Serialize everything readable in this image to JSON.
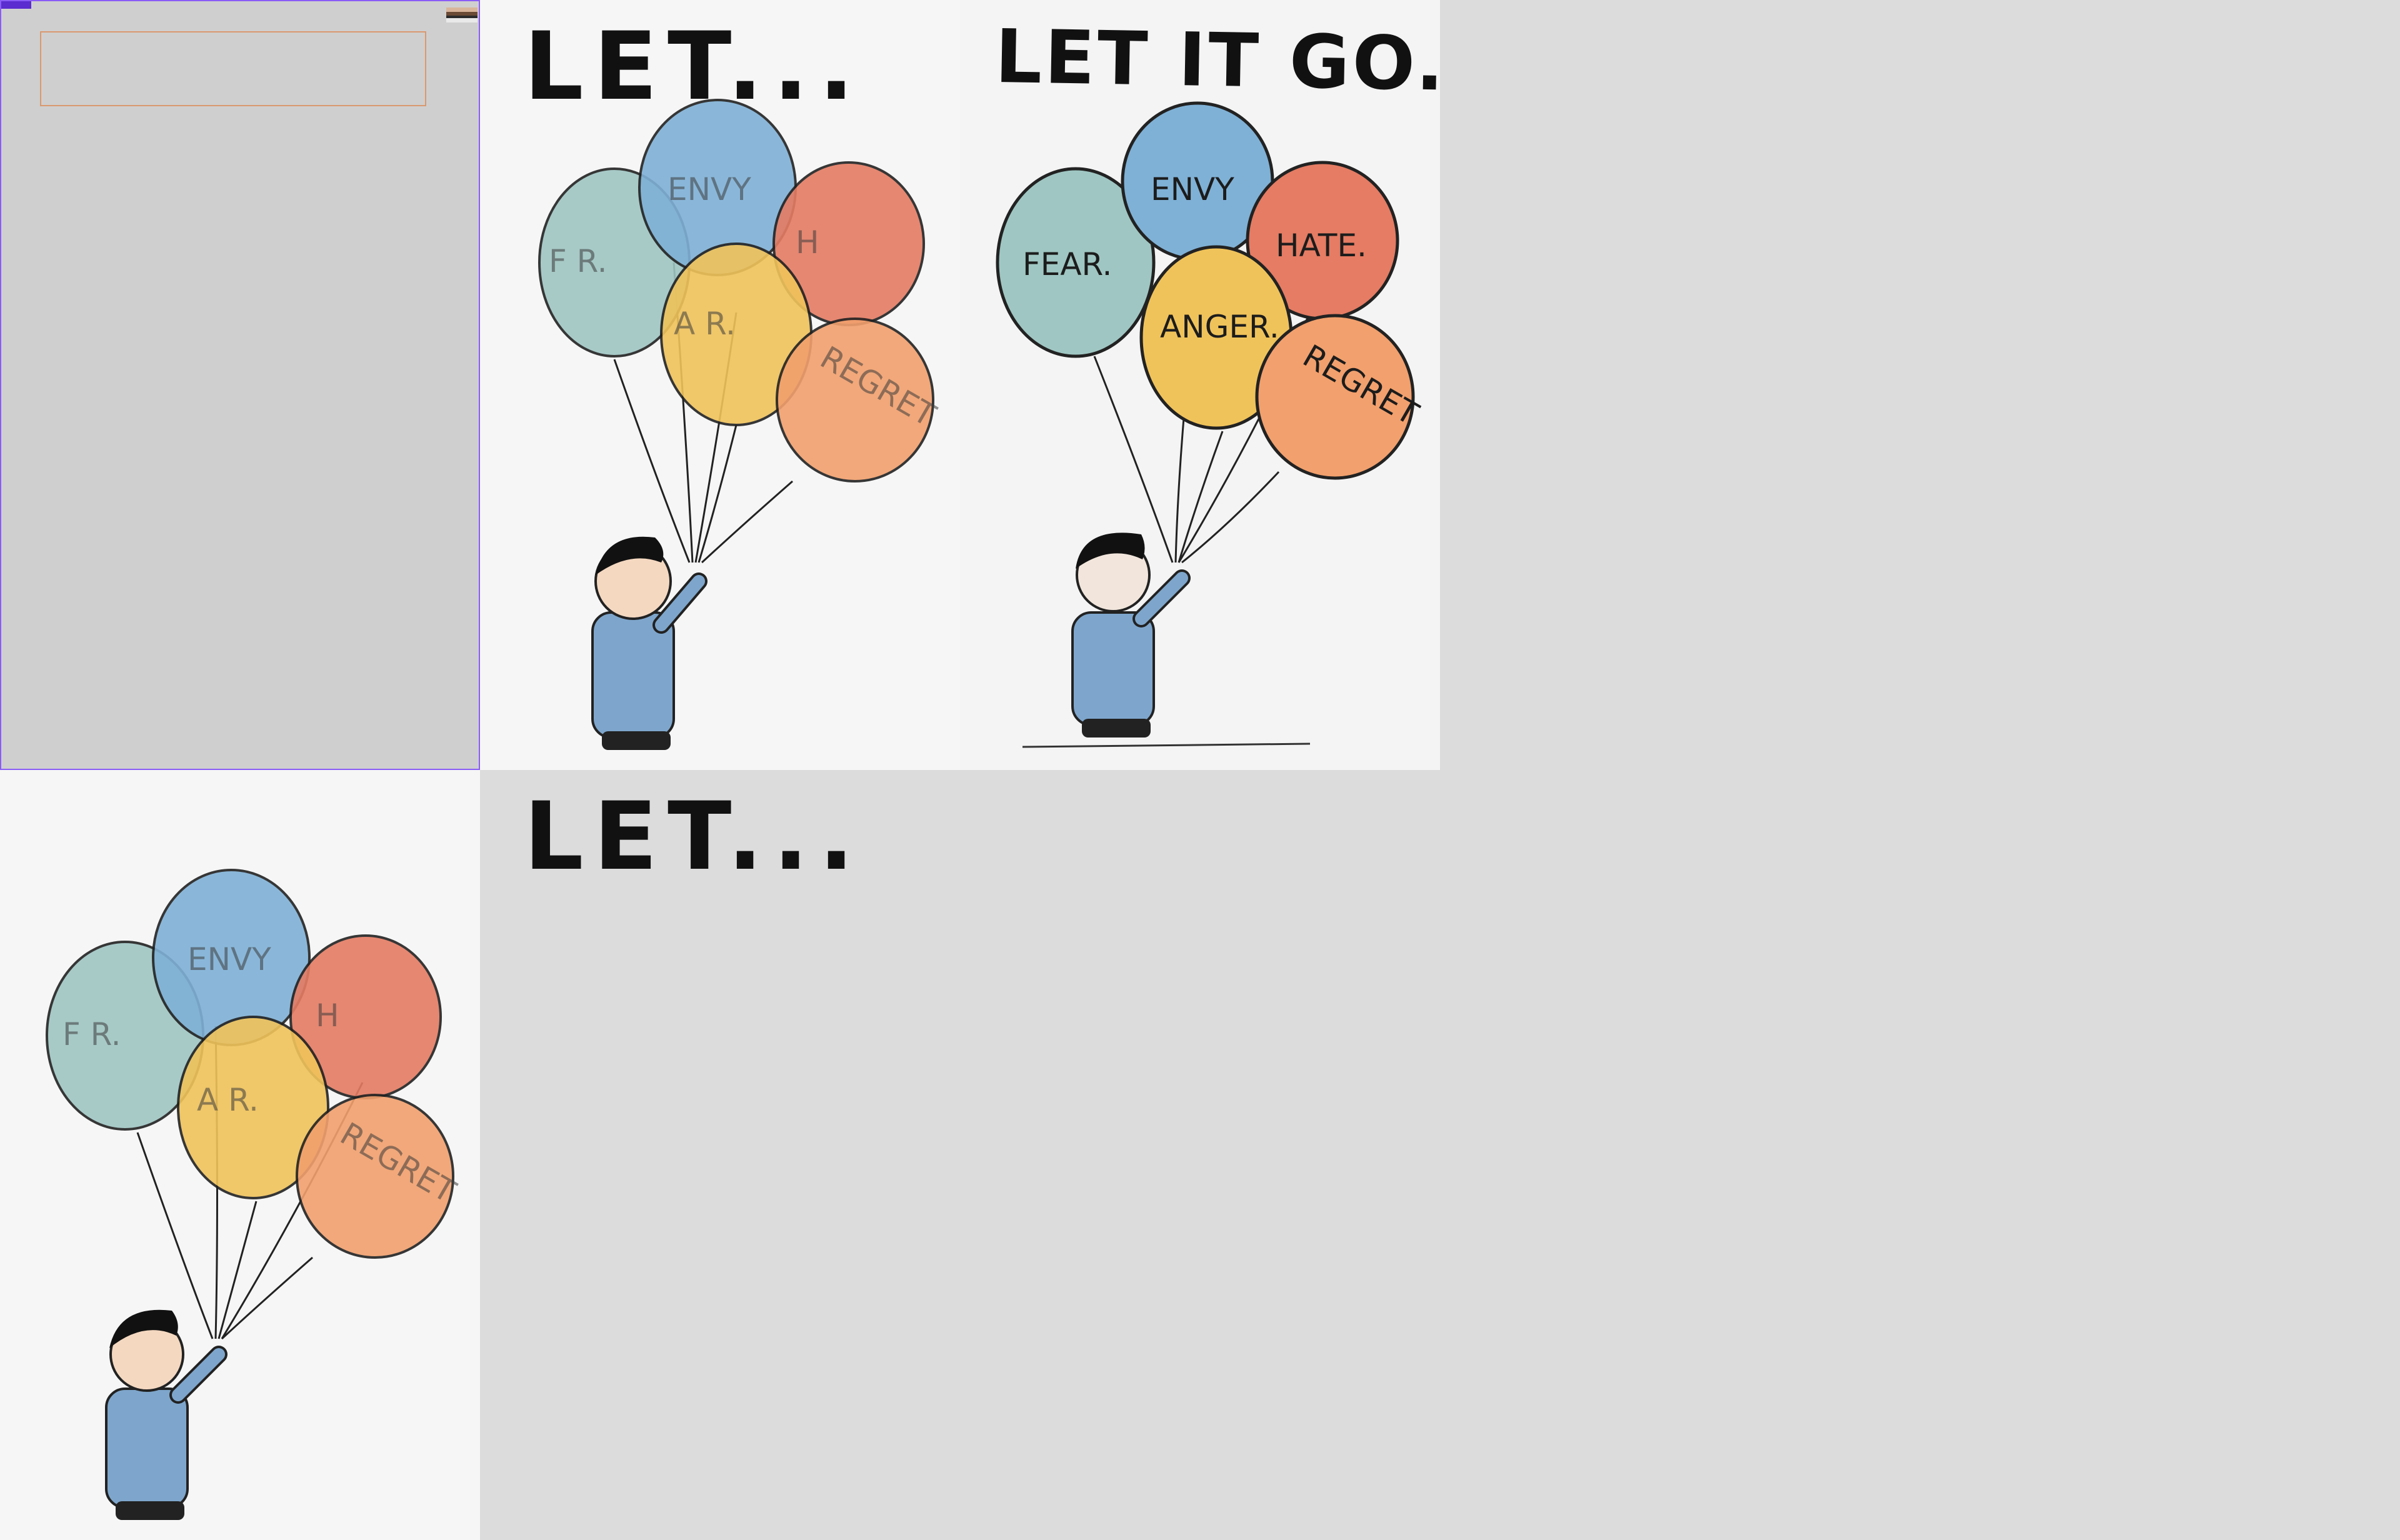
{
  "tiles": [
    {
      "id": "tile-1",
      "badge_text": "",
      "contents": "empty"
    },
    {
      "id": "tile-2",
      "title": "LET...",
      "balloons": [
        "FEAR.",
        "ENVY",
        "HATE.",
        "ANGER.",
        "REGRET"
      ],
      "balloon_labels_visible": [
        "F  R.",
        "ENVY",
        "H",
        "A   R.",
        "REGRET"
      ]
    },
    {
      "id": "tile-3",
      "title": "LET IT GO...",
      "balloons": [
        "FEAR.",
        "ENVY",
        "HATE.",
        "ANGER.",
        "REGRET"
      ]
    },
    {
      "id": "tile-4",
      "balloons": [
        "F  R.",
        "ENVY",
        "H",
        "A   R.",
        "REGRET"
      ]
    },
    {
      "id": "tile-5",
      "title": "LET..."
    }
  ],
  "colors": {
    "canvas": "#dcdcdc",
    "selection_border": "#8a5cf6",
    "empty_box_border": "#d99870",
    "balloon_fear": "#9fc6c2",
    "balloon_envy": "#7fb1d6",
    "balloon_hate": "#e57c63",
    "balloon_anger": "#f0c35a",
    "balloon_regret": "#f2a06d",
    "shirt": "#7ea6cc"
  }
}
